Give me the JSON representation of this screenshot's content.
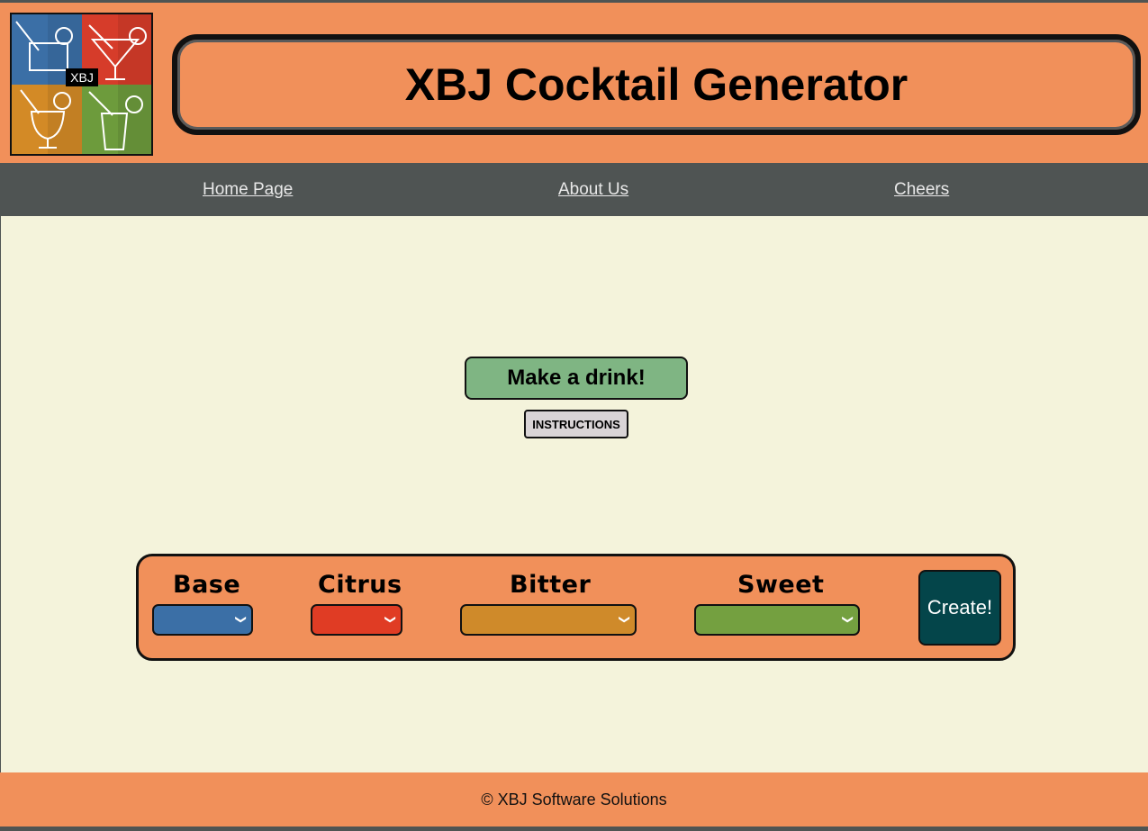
{
  "header": {
    "title": "XBJ Cocktail Generator",
    "logo_text": "XBJ",
    "logo_colors": [
      "#3b6fa6",
      "#d63c2a",
      "#d38a26",
      "#6d9b3c"
    ]
  },
  "nav": {
    "items": [
      {
        "label": "Home Page"
      },
      {
        "label": "About Us"
      },
      {
        "label": "Cheers"
      }
    ]
  },
  "main": {
    "make_button": "Make a drink!",
    "instructions_button": "INSTRUCTIONS"
  },
  "generator": {
    "fields": [
      {
        "label": "Base",
        "color": "#3b6fa6",
        "value": ""
      },
      {
        "label": "Citrus",
        "color": "#e03c24",
        "value": ""
      },
      {
        "label": "Bitter",
        "color": "#cf8a2a",
        "value": ""
      },
      {
        "label": "Sweet",
        "color": "#74a040",
        "value": ""
      }
    ],
    "create_button": "Create!"
  },
  "footer": {
    "text": "© XBJ Software Solutions"
  },
  "colors": {
    "header_bg": "#f1905a",
    "nav_bg": "#4f5453",
    "page_bg": "#f4f3db",
    "make_button_bg": "#7fb583",
    "create_button_bg": "#04454a"
  }
}
